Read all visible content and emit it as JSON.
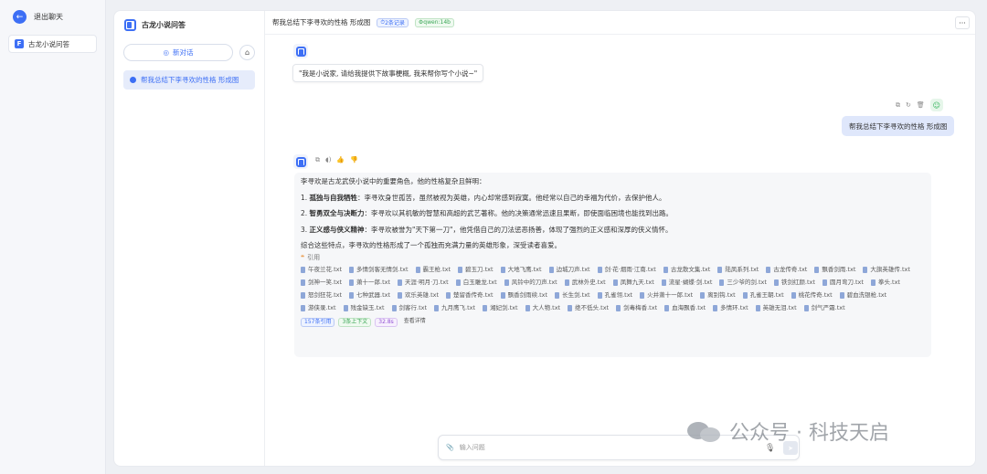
{
  "leftbar": {
    "exit_label": "退出聊天",
    "app_item": "古龙小说问答"
  },
  "sidebar": {
    "app_name": "古龙小说问答",
    "new_chat": "新对话",
    "history": [
      "帮我总结下李寻欢的性格 形成图"
    ]
  },
  "topbar": {
    "title": "帮我总结下李寻欢的性格 形成图",
    "records_badge": "2条记录",
    "model_badge": "qwen:14b",
    "more": "···"
  },
  "chat": {
    "greeting": "\"我是小说家, 请给我提供下故事梗概, 我来帮你写个小说~\"",
    "user_message": "帮我总结下李寻欢的性格 形成图",
    "answer": {
      "intro": "李寻欢是古龙武侠小说中的重要角色，他的性格复杂且鲜明：",
      "points": [
        {
          "num": "1.",
          "bold": "孤独与自我牺牲",
          "text": "：李寻欢身世孤苦，虽然被视为英雄，内心却常感到寂寞。他经常以自己的幸福为代价，去保护他人。"
        },
        {
          "num": "2.",
          "bold": "智勇双全与决断力",
          "text": "：李寻欢以其机敏的智慧和高超的武艺著称。他的决策通常迅速且果断，即使面临困境也能找到出路。"
        },
        {
          "num": "3.",
          "bold": "正义感与侠义精神",
          "text": "：李寻欢被誉为\"天下第一刀\"，他凭借自己的刀法惩恶扬善，体现了强烈的正义感和深厚的侠义情怀。"
        }
      ],
      "summary": "综合这些特点，李寻欢的性格形成了一个孤独而充满力量的英雄形象，深受读者喜爱。",
      "cite_label": "引用",
      "files": [
        "午夜兰花.txt",
        "多情剑客无情剑.txt",
        "霸王枪.txt",
        "碧玉刀.txt",
        "大地飞鹰.txt",
        "边城刀声.txt",
        "剑·花·烟雨·江南.txt",
        "古龙散文集.txt",
        "陆凤系列.txt",
        "古龙传奇.txt",
        "飘香剑雨.txt",
        "大旗英雄传.txt",
        "剑神一笑.txt",
        "萧十一郎.txt",
        "天涯·明月·刀.txt",
        "白玉雕龙.txt",
        "风铃中的刀声.txt",
        "武林外史.txt",
        "凤舞九天.txt",
        "流星·蝴蝶·剑.txt",
        "三少爷的剑.txt",
        "铁剑红颜.txt",
        "圆月弯刀.txt",
        "拳头.txt",
        "怒剑狂花.txt",
        "七种武器.txt",
        "欢乐英雄.txt",
        "楚留香传奇.txt",
        "飘香剑雨续.txt",
        "长生剑.txt",
        "孔雀翎.txt",
        "火并萧十一郎.txt",
        "离别钩.txt",
        "孔雀王朝.txt",
        "桃花传奇.txt",
        "碧血洗银枪.txt",
        "游侠录.txt",
        "残金缺玉.txt",
        "剑客行.txt",
        "九月鹰飞.txt",
        "湘妃剑.txt",
        "大人物.txt",
        "绝不低头.txt",
        "剑毒梅香.txt",
        "血海飘香.txt",
        "多情环.txt",
        "英雄无泪.txt",
        "剑气严霜.txt"
      ],
      "tags": [
        "157条引用",
        "3条上下文",
        "32.8s",
        "查看详情"
      ]
    }
  },
  "input": {
    "placeholder": "输入问题"
  },
  "watermark": "公众号 · 科技天启"
}
